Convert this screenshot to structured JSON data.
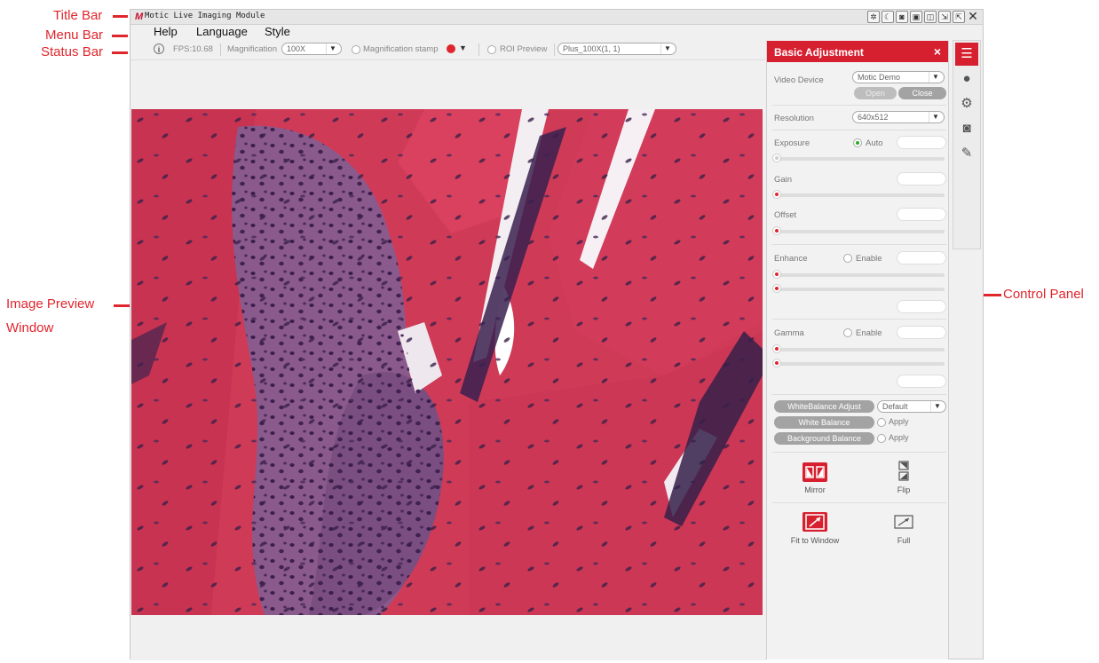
{
  "annotations": {
    "title_bar": "Title Bar",
    "menu_bar": "Menu Bar",
    "status_bar": "Status Bar",
    "image_preview_1": "Image Preview",
    "image_preview_2": "Window",
    "control_panel": "Control Panel",
    "color": "#e0262d"
  },
  "window": {
    "title": "Motic Live Imaging Module",
    "logo": "M",
    "controls": [
      "settings-icon",
      "moon-icon",
      "camera-icon",
      "window-icon",
      "split-icon",
      "shrink-icon",
      "expand-icon",
      "close-icon"
    ]
  },
  "menu": {
    "items": [
      "Help",
      "Language",
      "Style"
    ]
  },
  "status": {
    "fps": "FPS:10.68",
    "magnification_label": "Magnification",
    "magnification_value": "100X",
    "magnification_stamp": "Magnification stamp",
    "stamp_color": "#e0262d",
    "roi_preview": "ROI Preview",
    "roi_value": "Plus_100X(1, 1)"
  },
  "control_panel": {
    "title": "Basic Adjustment",
    "close": "×",
    "accent": "#d7202f",
    "video_device_label": "Video Device",
    "video_device_value": "Motic Demo",
    "open_label": "Open",
    "close_label": "Close",
    "resolution_label": "Resolution",
    "resolution_value": "640x512",
    "exposure_label": "Exposure",
    "exposure_auto": "Auto",
    "gain_label": "Gain",
    "offset_label": "Offset",
    "enhance_label": "Enhance",
    "enhance_enable": "Enable",
    "gamma_label": "Gamma",
    "gamma_enable": "Enable",
    "wb_adjust_label": "WhiteBalance Adjust",
    "wb_adjust_value": "Default",
    "white_balance_label": "White Balance",
    "white_balance_apply": "Apply",
    "background_balance_label": "Background Balance",
    "background_balance_apply": "Apply",
    "mirror_label": "Mirror",
    "flip_label": "Flip",
    "fit_label": "Fit to Window",
    "full_label": "Full"
  },
  "side_tabs": [
    "sliders-icon",
    "color-balls-icon",
    "gears-icon",
    "camera-icon",
    "ruler-icon"
  ]
}
